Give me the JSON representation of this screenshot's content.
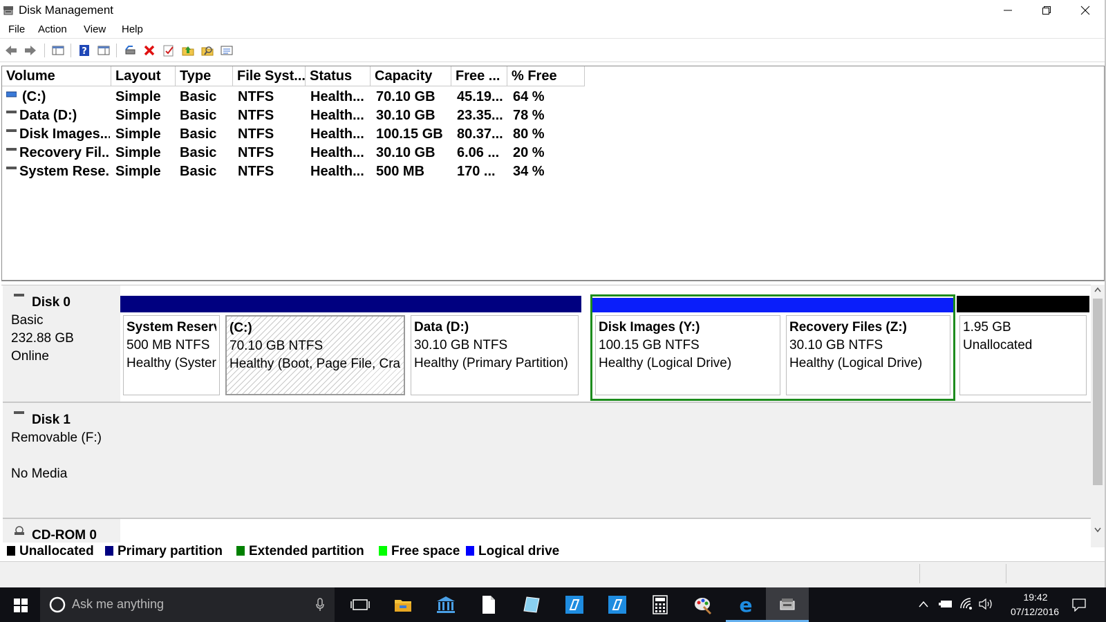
{
  "window": {
    "title": "Disk Management"
  },
  "menu": [
    "File",
    "Action",
    "View",
    "Help"
  ],
  "volume_list": {
    "columns": [
      "Volume",
      "Layout",
      "Type",
      "File Syst...",
      "Status",
      "Capacity",
      "Free ...",
      "% Free"
    ],
    "rows": [
      {
        "volume": "(C:)",
        "layout": "Simple",
        "type": "Basic",
        "fs": "NTFS",
        "status": "Health...",
        "capacity": "70.10 GB",
        "free": "45.19...",
        "pct": "64 %"
      },
      {
        "volume": "Data (D:)",
        "layout": "Simple",
        "type": "Basic",
        "fs": "NTFS",
        "status": "Health...",
        "capacity": "30.10 GB",
        "free": "23.35...",
        "pct": "78 %"
      },
      {
        "volume": "Disk Images...",
        "layout": "Simple",
        "type": "Basic",
        "fs": "NTFS",
        "status": "Health...",
        "capacity": "100.15 GB",
        "free": "80.37...",
        "pct": "80 %"
      },
      {
        "volume": "Recovery Fil...",
        "layout": "Simple",
        "type": "Basic",
        "fs": "NTFS",
        "status": "Health...",
        "capacity": "30.10 GB",
        "free": "6.06 ...",
        "pct": "20 %"
      },
      {
        "volume": "System Rese...",
        "layout": "Simple",
        "type": "Basic",
        "fs": "NTFS",
        "status": "Health...",
        "capacity": "500 MB",
        "free": "170 ...",
        "pct": "34 %"
      }
    ]
  },
  "disks": [
    {
      "name": "Disk 0",
      "info": [
        "Basic",
        "232.88 GB",
        "Online"
      ]
    },
    {
      "name": "Disk 1",
      "info": [
        "Removable (F:)",
        "",
        "No Media"
      ]
    },
    {
      "name": "CD-ROM 0"
    }
  ],
  "partitions": [
    {
      "title": "System Reserv",
      "size": "500 MB NTFS",
      "health": "Healthy (Syster",
      "bar": "#000080"
    },
    {
      "title": "(C:)",
      "size": "70.10 GB NTFS",
      "health": "Healthy (Boot, Page File, Cras",
      "bar": "#000080"
    },
    {
      "title": "Data  (D:)",
      "size": "30.10 GB NTFS",
      "health": "Healthy (Primary Partition)",
      "bar": "#000080"
    },
    {
      "title": "Disk Images  (Y:)",
      "size": "100.15 GB NTFS",
      "health": "Healthy (Logical Drive)",
      "bar": "#0000ff"
    },
    {
      "title": "Recovery Files  (Z:)",
      "size": "30.10 GB NTFS",
      "health": "Healthy (Logical Drive)",
      "bar": "#0000ff"
    },
    {
      "title": "",
      "size": "1.95 GB",
      "health": "Unallocated",
      "bar": "#000000"
    }
  ],
  "legend": [
    {
      "label": "Unallocated",
      "color": "#000000"
    },
    {
      "label": "Primary partition",
      "color": "#000080"
    },
    {
      "label": "Extended partition",
      "color": "#008000"
    },
    {
      "label": "Free space",
      "color": "#00ff00"
    },
    {
      "label": "Logical drive",
      "color": "#0000ff"
    }
  ],
  "taskbar": {
    "search_placeholder": "Ask me anything",
    "time": "19:42",
    "date": "07/12/2016"
  },
  "colors": {
    "accent": "#0078d7",
    "extended_border": "#1d8c1d"
  }
}
